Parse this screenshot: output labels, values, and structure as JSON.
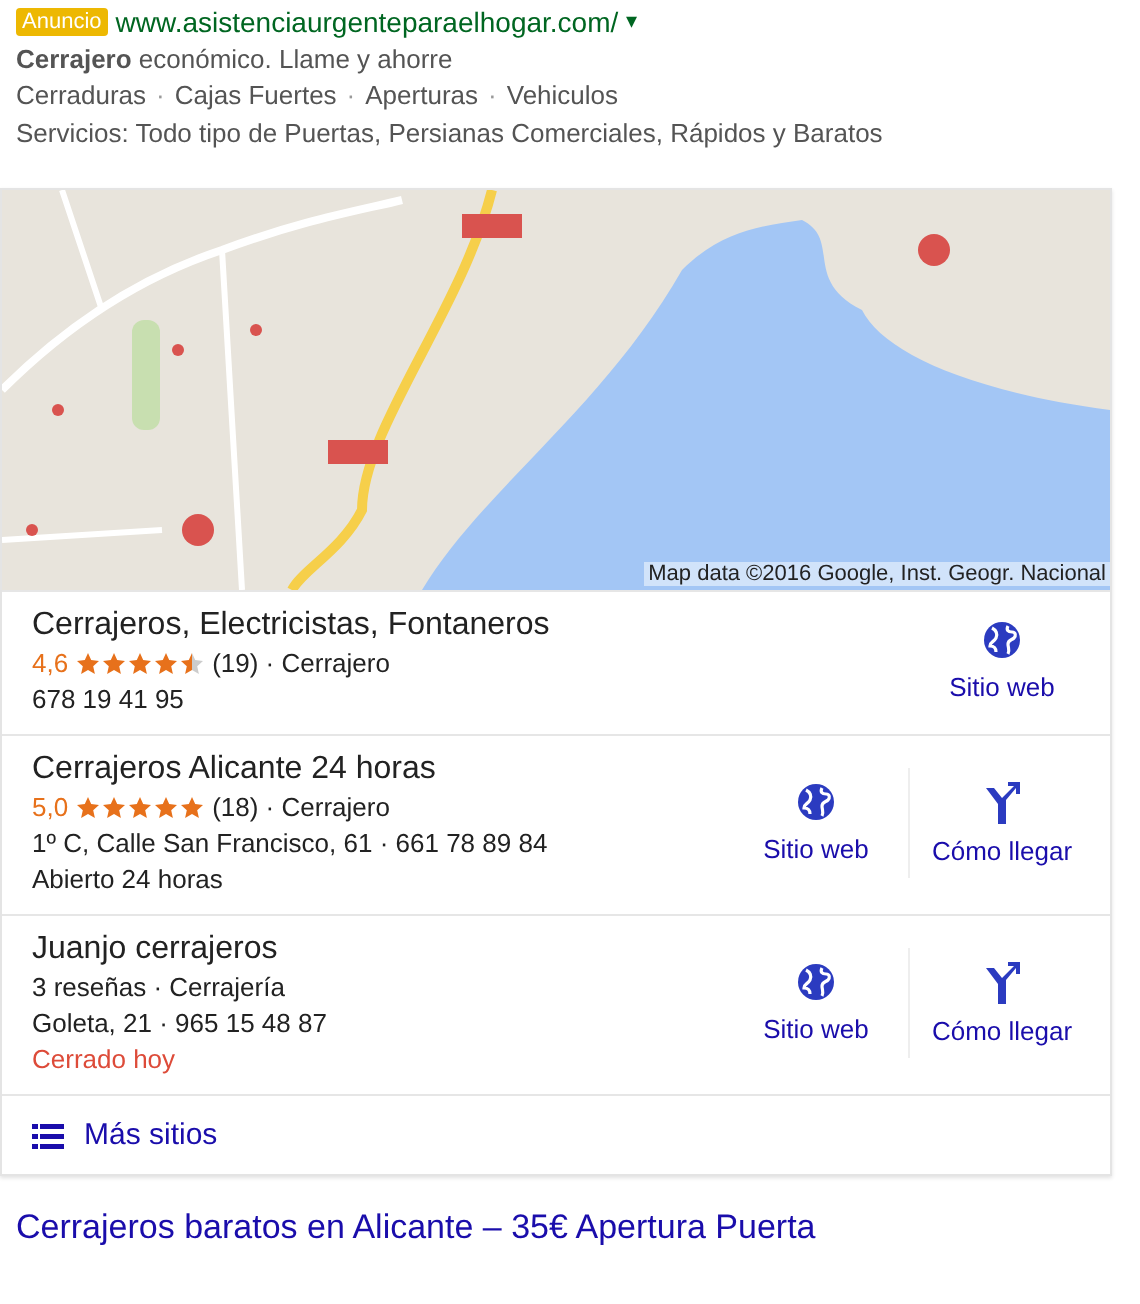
{
  "ad": {
    "badge": "Anuncio",
    "url": "www.asistenciaurgenteparaelhogar.com/",
    "dropdown": "▾",
    "headline_line": "**Cerrajero** económico. Llame y ahorre",
    "sitelinks": [
      "Cerraduras",
      "Cajas Fuertes",
      "Aperturas",
      "Vehiculos"
    ],
    "separator": "·",
    "description": "Servicios: Todo tipo de Puertas, Persianas Comerciales, Rápidos y Baratos"
  },
  "map": {
    "kind": "picture",
    "attribution": "Map data ©2016 Google, Inst. Geogr. Nacional"
  },
  "listings": [
    {
      "name": "Cerrajeros, Electricistas, Fontaneros",
      "rating": "4,6",
      "stars": 4.5,
      "reviews_category": "(19) · Cerrajero",
      "details": [
        "678 19 41 95"
      ],
      "actions": [
        {
          "kind": "website",
          "label": "Sitio web"
        }
      ]
    },
    {
      "name": "Cerrajeros Alicante 24 horas",
      "rating": "5,0",
      "stars": 5,
      "reviews_category": "(18) · Cerrajero",
      "details": [
        "1º C, Calle San Francisco, 61 · 661 78 89 84",
        "Abierto 24 horas"
      ],
      "actions": [
        {
          "kind": "website",
          "label": "Sitio web"
        },
        {
          "kind": "directions",
          "label": "Cómo llegar"
        }
      ]
    },
    {
      "name": "Juanjo cerrajeros",
      "reviews_category": "3 reseñas · Cerrajería",
      "details": [
        "Goleta, 21 · 965 15 48 87"
      ],
      "status": "Cerrado hoy",
      "actions": [
        {
          "kind": "website",
          "label": "Sitio web"
        },
        {
          "kind": "directions",
          "label": "Cómo llegar"
        }
      ]
    }
  ],
  "more": {
    "label": "Más sitios"
  },
  "result": {
    "title": "Cerrajeros baratos en Alicante – 35€ Apertura Puerta"
  }
}
